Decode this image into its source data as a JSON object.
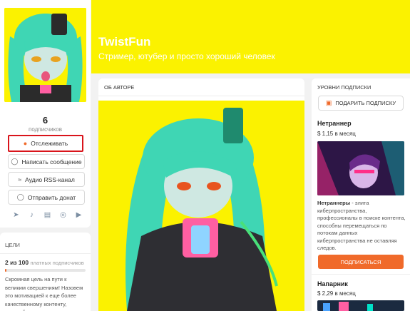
{
  "profile": {
    "name": "TwistFun",
    "tagline": "Стример, ютубер и просто хороший человек",
    "subscribers_count": "6",
    "subscribers_label": "подписчиков"
  },
  "actions": {
    "follow": "Отслеживать",
    "message": "Написать сообщение",
    "rss": "Аудио RSS-канал",
    "donate": "Отправить донат"
  },
  "socials": [
    "telegram-icon",
    "tiktok-icon",
    "twitch-icon",
    "web-icon",
    "youtube-icon"
  ],
  "goals": {
    "title": "ЦЕЛИ",
    "progress_bold": "2 из 100",
    "progress_suffix": "платных подписчиков",
    "progress_fraction": 0.02,
    "text": "Скромная цель на пути к великим свершениям! Назовем это мотивацией к еще более качественному контенту, который я смогу выпускать еще"
  },
  "about": {
    "title": "ОБ АВТОРЕ"
  },
  "tiers": {
    "title": "УРОВНИ ПОДПИСКИ",
    "gift_label": "ПОДАРИТЬ ПОДПИСКУ",
    "items": [
      {
        "name": "Нетраннер",
        "price": "$ 1,15 в месяц",
        "desc_bold": "Нетраннеры",
        "desc": " - элита киберпространства, профессионалы в поиске контента, способны перемещаться по потокам данных киберпространства не оставляя следов.",
        "button": "ПОДПИСАТЬСЯ"
      },
      {
        "name": "Напарник",
        "price": "$ 2,29 в месяц"
      }
    ]
  },
  "colors": {
    "accent": "#f06a2a",
    "banner": "#fbf200",
    "follow_border": "#d9141b",
    "avatar_hair": "#3fd6b4"
  }
}
